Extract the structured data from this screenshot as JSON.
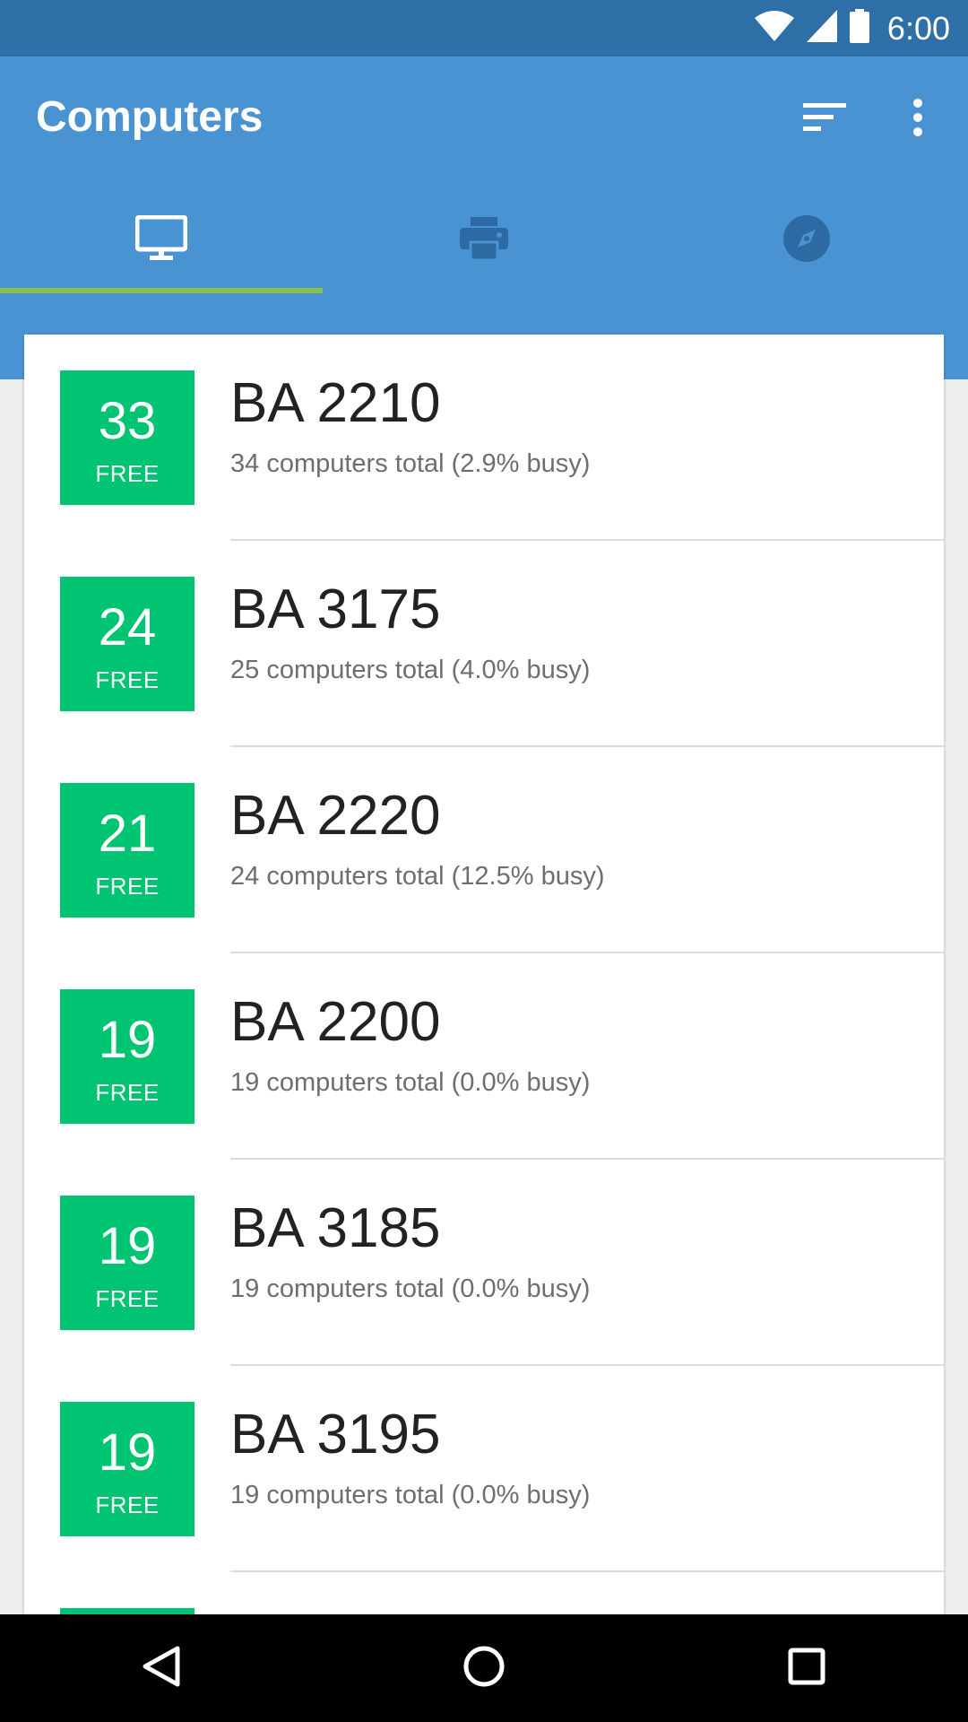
{
  "status_bar": {
    "time": "6:00"
  },
  "app_bar": {
    "title": "Computers",
    "actions": {
      "sort_icon": "sort-icon",
      "more_icon": "more-vert-icon"
    }
  },
  "tabs": [
    {
      "icon": "monitor-icon",
      "selected": true
    },
    {
      "icon": "printer-icon",
      "selected": false
    },
    {
      "icon": "compass-icon",
      "selected": false
    }
  ],
  "colors": {
    "status_bar": "#2f6fa8",
    "app_bar": "#4a93d2",
    "tab_indicator": "#8bc34a",
    "badge": "#00c471"
  },
  "labs": [
    {
      "free": "33",
      "free_label": "FREE",
      "name": "BA 2210",
      "detail": "34 computers total (2.9% busy)"
    },
    {
      "free": "24",
      "free_label": "FREE",
      "name": "BA 3175",
      "detail": "25 computers total (4.0% busy)"
    },
    {
      "free": "21",
      "free_label": "FREE",
      "name": "BA 2220",
      "detail": "24 computers total (12.5% busy)"
    },
    {
      "free": "19",
      "free_label": "FREE",
      "name": "BA 2200",
      "detail": "19 computers total (0.0% busy)"
    },
    {
      "free": "19",
      "free_label": "FREE",
      "name": "BA 3185",
      "detail": "19 computers total (0.0% busy)"
    },
    {
      "free": "19",
      "free_label": "FREE",
      "name": "BA 3195",
      "detail": "19 computers total (0.0% busy)"
    }
  ]
}
